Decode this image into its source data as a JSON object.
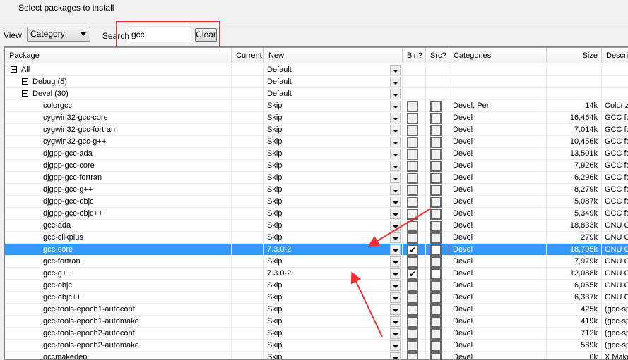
{
  "subtitle": "Select packages to install",
  "toolbar": {
    "view_label": "View",
    "view_value": "Category",
    "search_label": "Search",
    "search_value": "gcc",
    "clear_label": "Clear"
  },
  "columns": [
    "Package",
    "Current",
    "New",
    "Bin?",
    "Src?",
    "Categories",
    "Size",
    "Descrip"
  ],
  "groups": [
    {
      "label": "All",
      "new": "Default",
      "expander": "minus",
      "level": 0
    },
    {
      "label": "Debug (5)",
      "new": "Default",
      "expander": "plus",
      "level": 1
    },
    {
      "label": "Devel (30)",
      "new": "Default",
      "expander": "minus",
      "level": 1
    }
  ],
  "packages": [
    {
      "name": "colorgcc",
      "new": "Skip",
      "bin": "off",
      "src": "off",
      "cat": "Devel, Perl",
      "size": "14k",
      "desc": "Colorize"
    },
    {
      "name": "cygwin32-gcc-core",
      "new": "Skip",
      "bin": "off",
      "src": "off",
      "cat": "Devel",
      "size": "16,464k",
      "desc": "GCC fo"
    },
    {
      "name": "cygwin32-gcc-fortran",
      "new": "Skip",
      "bin": "off",
      "src": "off",
      "cat": "Devel",
      "size": "7,014k",
      "desc": "GCC fo"
    },
    {
      "name": "cygwin32-gcc-g++",
      "new": "Skip",
      "bin": "off",
      "src": "off",
      "cat": "Devel",
      "size": "10,456k",
      "desc": "GCC fo"
    },
    {
      "name": "djgpp-gcc-ada",
      "new": "Skip",
      "bin": "off",
      "src": "off",
      "cat": "Devel",
      "size": "13,501k",
      "desc": "GCC fo"
    },
    {
      "name": "djgpp-gcc-core",
      "new": "Skip",
      "bin": "off",
      "src": "off",
      "cat": "Devel",
      "size": "7,926k",
      "desc": "GCC fo"
    },
    {
      "name": "djgpp-gcc-fortran",
      "new": "Skip",
      "bin": "off",
      "src": "off",
      "cat": "Devel",
      "size": "6,296k",
      "desc": "GCC fo"
    },
    {
      "name": "djgpp-gcc-g++",
      "new": "Skip",
      "bin": "off",
      "src": "off",
      "cat": "Devel",
      "size": "8,279k",
      "desc": "GCC fo"
    },
    {
      "name": "djgpp-gcc-objc",
      "new": "Skip",
      "bin": "off",
      "src": "off",
      "cat": "Devel",
      "size": "5,087k",
      "desc": "GCC fo"
    },
    {
      "name": "djgpp-gcc-objc++",
      "new": "Skip",
      "bin": "off",
      "src": "off",
      "cat": "Devel",
      "size": "5,349k",
      "desc": "GCC fo"
    },
    {
      "name": "gcc-ada",
      "new": "Skip",
      "bin": "off",
      "src": "off",
      "cat": "Devel",
      "size": "18,833k",
      "desc": "GNU C"
    },
    {
      "name": "gcc-cilkplus",
      "new": "Skip",
      "bin": "off",
      "src": "off",
      "cat": "Devel",
      "size": "279k",
      "desc": "GNU C"
    },
    {
      "name": "gcc-core",
      "new": "7.3.0-2",
      "bin": "checked",
      "src": "empty",
      "cat": "Devel",
      "size": "18,705k",
      "desc": "GNU C",
      "selected": true
    },
    {
      "name": "gcc-fortran",
      "new": "Skip",
      "bin": "off",
      "src": "off",
      "cat": "Devel",
      "size": "7,979k",
      "desc": "GNU C"
    },
    {
      "name": "gcc-g++",
      "new": "7.3.0-2",
      "bin": "checked",
      "src": "empty",
      "cat": "Devel",
      "size": "12,088k",
      "desc": "GNU C"
    },
    {
      "name": "gcc-objc",
      "new": "Skip",
      "bin": "off",
      "src": "off",
      "cat": "Devel",
      "size": "6,055k",
      "desc": "GNU C"
    },
    {
      "name": "gcc-objc++",
      "new": "Skip",
      "bin": "off",
      "src": "off",
      "cat": "Devel",
      "size": "6,337k",
      "desc": "GNU C"
    },
    {
      "name": "gcc-tools-epoch1-autoconf",
      "new": "Skip",
      "bin": "off",
      "src": "off",
      "cat": "Devel",
      "size": "425k",
      "desc": "(gcc-sp"
    },
    {
      "name": "gcc-tools-epoch1-automake",
      "new": "Skip",
      "bin": "off",
      "src": "off",
      "cat": "Devel",
      "size": "419k",
      "desc": "(gcc-sp"
    },
    {
      "name": "gcc-tools-epoch2-autoconf",
      "new": "Skip",
      "bin": "off",
      "src": "off",
      "cat": "Devel",
      "size": "712k",
      "desc": "(gcc-sp"
    },
    {
      "name": "gcc-tools-epoch2-automake",
      "new": "Skip",
      "bin": "off",
      "src": "off",
      "cat": "Devel",
      "size": "589k",
      "desc": "(gcc-sp"
    },
    {
      "name": "gccmakedep",
      "new": "Skip",
      "bin": "off",
      "src": "off",
      "cat": "Devel",
      "size": "6k",
      "desc": "X Make"
    }
  ],
  "colors": {
    "selection": "#3399ff",
    "annotation": "#f03030"
  }
}
